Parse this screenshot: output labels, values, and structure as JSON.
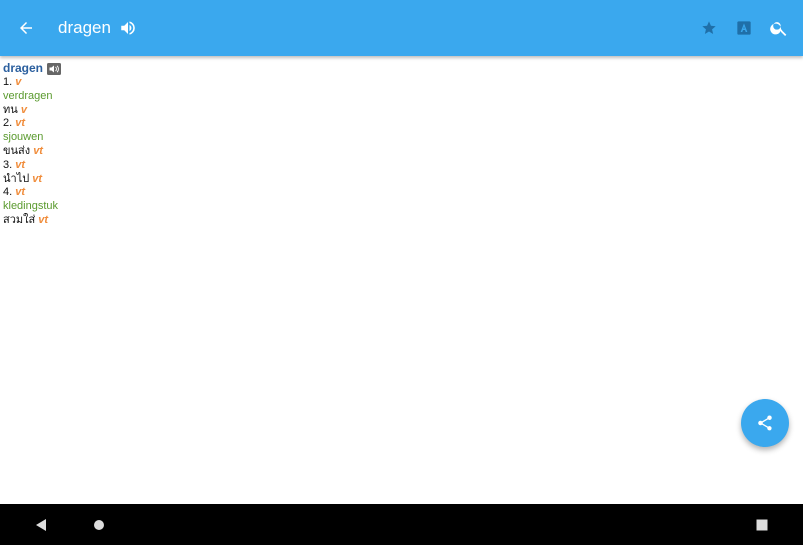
{
  "appbar": {
    "title": "dragen",
    "background": "#3aa8ee",
    "icons": [
      "back-arrow-icon",
      "speaker-icon",
      "star-icon",
      "translate-icon",
      "search-icon"
    ]
  },
  "entry": {
    "headword": "dragen",
    "senses": [
      {
        "number": "1.",
        "pos": "v",
        "nl": "verdragen",
        "th": "ทน",
        "th_pos": "v"
      },
      {
        "number": "2.",
        "pos": "vt",
        "nl": "sjouwen",
        "th": "ขนส่ง",
        "th_pos": "vt"
      },
      {
        "number": "3.",
        "pos": "vt",
        "nl": "",
        "th": "นำไป",
        "th_pos": "vt"
      },
      {
        "number": "4.",
        "pos": "vt",
        "nl": "kledingstuk",
        "th": "สวมใส่",
        "th_pos": "vt"
      }
    ],
    "colors": {
      "headword": "#2b5f9e",
      "pos": "#f08c3a",
      "nl": "#5a9a2e"
    }
  },
  "fab": {
    "icon": "share-icon"
  },
  "navbar": {
    "icons": [
      "nav-back-icon",
      "nav-home-icon",
      "nav-recents-icon"
    ]
  }
}
